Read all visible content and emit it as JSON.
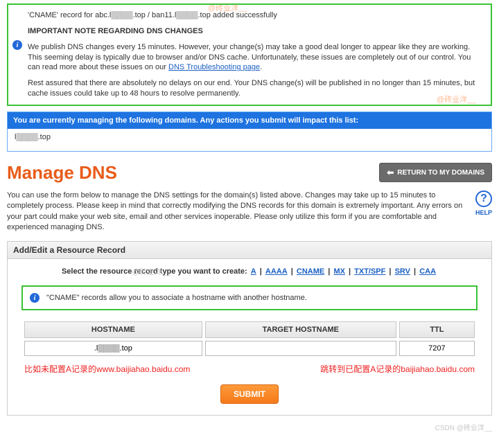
{
  "watermarks": {
    "w1": "@砖业洋__",
    "w2": "@砖业洋__",
    "w3": "@砖业洋__"
  },
  "success": {
    "message": "'CNAME' record for abc.l▒▒▒▒.top / ban11.l▒▒▒▒.top added successfully"
  },
  "notice": {
    "heading": "IMPORTANT NOTE REGARDING DNS CHANGES",
    "p1_a": "We publish DNS changes every 15 minutes. However, your change(s) may take a good deal longer to appear like they are working. This seeming delay is typically due to browser and/or DNS cache. Unfortunately, these issues are completely out of our control. You can read more about these issues on our ",
    "p1_link": "DNS Troubleshooting page",
    "p1_b": ".",
    "p2": "Rest assured that there are absolutely no delays on our end. Your DNS change(s) will be published in no longer than 15 minutes, but cache issues could take up to 48 hours to resolve permanently."
  },
  "domains_bar": "You are currently managing the following domains. Any actions you submit will impact this list:",
  "domain_item": "l▒▒▒▒.top",
  "page_title": "Manage DNS",
  "return_btn": "RETURN TO MY DOMAINS",
  "intro": "You can use the form below to manage the DNS settings for the domain(s) listed above. Changes may take up to 15 minutes to completely process. Please keep in mind that correctly modifying the DNS records for this domain is extremely important. Any errors on your part could make your web site, email and other services inoperable. Please only utilize this form if you are comfortable and experienced managing DNS.",
  "help_label": "HELP",
  "section_title": "Add/Edit a Resource Record",
  "type_prefix": "Select the resource record type you want to create: ",
  "types": {
    "a": "A",
    "aaaa": "AAAA",
    "cname": "CNAME",
    "mx": "MX",
    "txt": "TXT/SPF",
    "srv": "SRV",
    "caa": "CAA"
  },
  "sep": " | ",
  "hint": "\"CNAME\" records allow you to associate a hostname with another hostname.",
  "table": {
    "col1": "HOSTNAME",
    "col2": "TARGET HOSTNAME",
    "col3": "TTL",
    "hostname_val": ".l▒▒▒▒.top",
    "target_val": "",
    "ttl_val": "7207"
  },
  "red_left": "比如未配置A记录的www.baijiahao.baidu.com",
  "red_right": "跳转到已配置A记录的baijiahao.baidu.com",
  "submit": "SUBMIT",
  "footer": "CSDN @砖业洋__"
}
